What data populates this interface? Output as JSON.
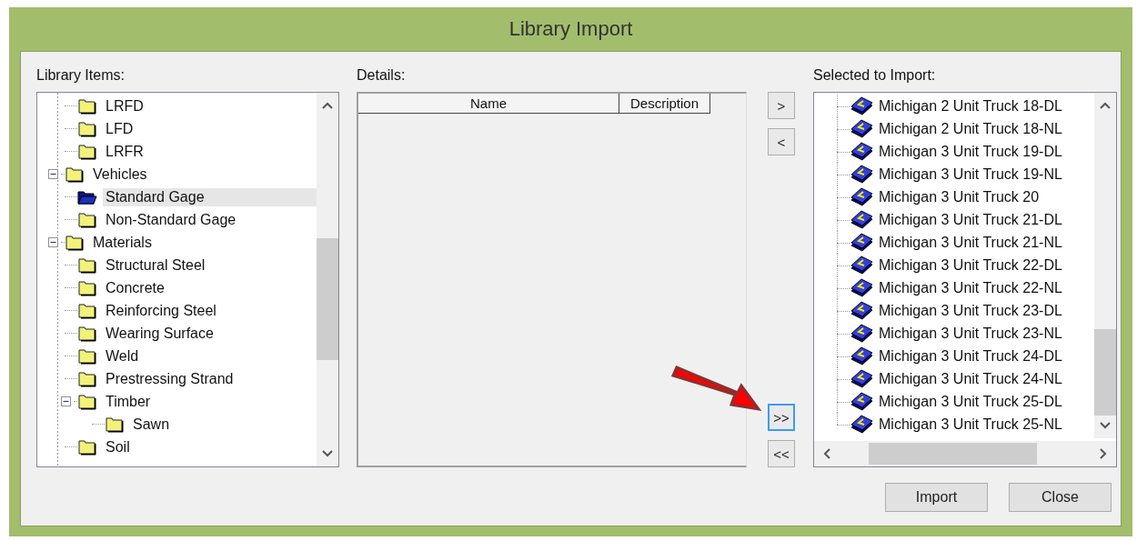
{
  "window": {
    "title": "Library Import"
  },
  "library_items": {
    "label": "Library Items:",
    "items": [
      {
        "children": [
          {
            "label": "LRFD"
          },
          {
            "label": "LFD"
          },
          {
            "label": "LRFR"
          }
        ]
      },
      {
        "label": "Vehicles",
        "expanded": true,
        "children": [
          {
            "label": "Standard Gage",
            "selected": true
          },
          {
            "label": "Non-Standard Gage",
            "selected": false
          }
        ]
      },
      {
        "label": "Materials",
        "expanded": true,
        "children": [
          {
            "label": "Structural Steel"
          },
          {
            "label": "Concrete"
          },
          {
            "label": "Reinforcing Steel"
          },
          {
            "label": "Wearing Surface"
          },
          {
            "label": "Weld"
          },
          {
            "label": "Prestressing Strand"
          },
          {
            "label": "Timber",
            "expanded": true,
            "children": [
              {
                "label": "Sawn"
              }
            ]
          },
          {
            "label": "Soil"
          }
        ]
      }
    ]
  },
  "details": {
    "label": "Details:",
    "columns": [
      "Name",
      "Description"
    ]
  },
  "transfer_buttons": [
    {
      "label": ">",
      "focused": false
    },
    {
      "label": "<",
      "focused": false
    },
    {
      "label": ">>",
      "focused": true
    },
    {
      "label": "<<",
      "focused": false
    }
  ],
  "selected_to_import": {
    "label": "Selected to Import:",
    "items": [
      "Michigan 2 Unit Truck 18-DL",
      "Michigan 2 Unit Truck 18-NL",
      "Michigan 3 Unit Truck 19-DL",
      "Michigan 3 Unit Truck 19-NL",
      "Michigan 3 Unit Truck 20",
      "Michigan 3 Unit Truck 21-DL",
      "Michigan 3 Unit Truck 21-NL",
      "Michigan 3 Unit Truck 22-DL",
      "Michigan 3 Unit Truck 22-NL",
      "Michigan 3 Unit Truck 23-DL",
      "Michigan 3 Unit Truck 23-NL",
      "Michigan 3 Unit Truck 24-DL",
      "Michigan 3 Unit Truck 24-NL",
      "Michigan 3 Unit Truck 25-DL",
      "Michigan 3 Unit Truck 25-NL"
    ]
  },
  "buttons": [
    "Import",
    "Close"
  ]
}
